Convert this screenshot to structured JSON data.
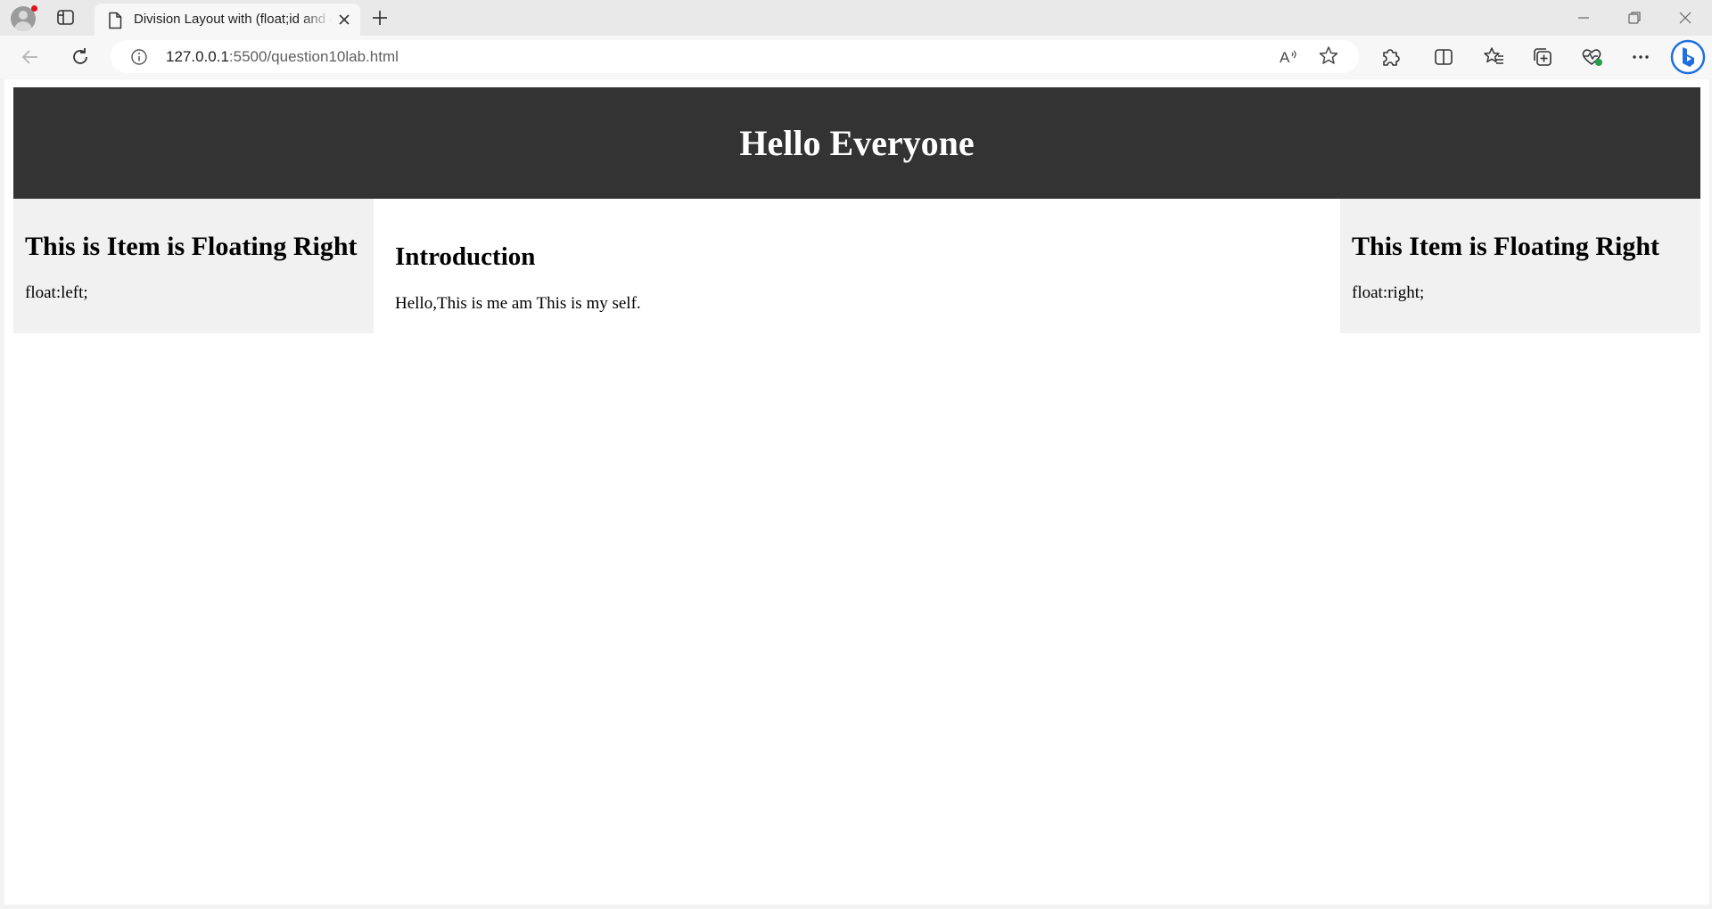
{
  "browser": {
    "tab": {
      "title": "Division Layout with (float;id and class)",
      "favicon": "page-icon"
    },
    "address_bar": {
      "host": "127.0.0.1",
      "path": ":5500/question10lab.html"
    },
    "icons": {
      "back": "back-arrow-icon",
      "reload": "reload-icon",
      "info": "info-icon",
      "read_aloud": "read-aloud-icon",
      "favorite": "star-icon",
      "extensions": "puzzle-icon",
      "split_screen": "split-screen-icon",
      "favorites": "favorites-icon",
      "collections": "collections-icon",
      "browser_essentials": "heart-pulse-icon",
      "more": "more-icon",
      "copilot": "bing-icon"
    },
    "colors": {
      "accent_notification": "#e0151a",
      "essentials_badge": "#22a04b",
      "copilot_blue": "#1f6fe0"
    }
  },
  "page": {
    "header": {
      "title": "Hello Everyone",
      "background": "#333333",
      "color": "#ffffff"
    },
    "left_aside": {
      "heading": "This is Item is Floating Right",
      "text": "float:left;",
      "background": "#f1f1f1"
    },
    "main": {
      "heading": "Introduction",
      "text": "Hello,This is me am This is my self."
    },
    "right_aside": {
      "heading": "This Item is Floating Right",
      "text": "float:right;",
      "background": "#f1f1f1"
    }
  }
}
